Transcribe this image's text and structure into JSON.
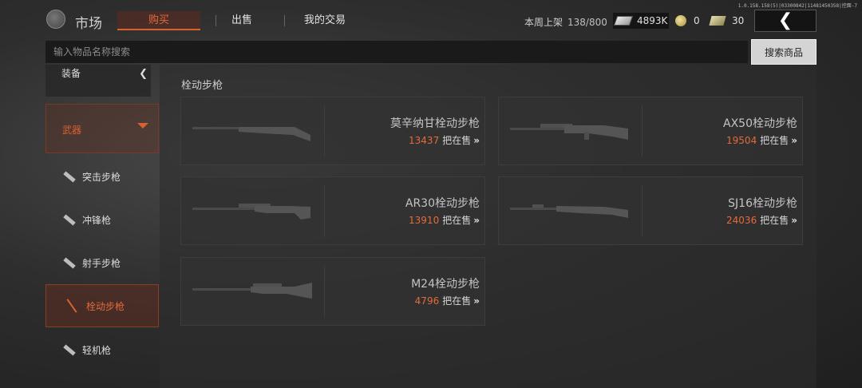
{
  "version_text": "1.0.158.158(5)|03300842|11481450358|控面-7",
  "header": {
    "title": "市场",
    "tabs": [
      {
        "label": "购买",
        "active": true
      },
      {
        "label": "出售",
        "active": false
      },
      {
        "label": "我的交易",
        "active": false
      }
    ],
    "weekly_label": "本周上架",
    "weekly_count": "138/800",
    "money": "4893K",
    "coins": "0",
    "tickets": "30",
    "back_icon": "chevron-left-icon"
  },
  "search": {
    "placeholder": "输入物品名称搜索",
    "button_label": "搜索商品"
  },
  "sidebar": {
    "equipment_label": "装备",
    "weapons_label": "武器",
    "items": [
      {
        "label": "突击步枪",
        "active": false
      },
      {
        "label": "冲锋枪",
        "active": false
      },
      {
        "label": "射手步枪",
        "active": false
      },
      {
        "label": "栓动步枪",
        "active": true
      },
      {
        "label": "轻机枪",
        "active": false
      }
    ]
  },
  "main": {
    "section_title": "栓动步枪",
    "on_sale_suffix": "把在售",
    "items": [
      {
        "name": "莫辛纳甘栓动步枪",
        "count": "13437"
      },
      {
        "name": "AX50栓动步枪",
        "count": "19504"
      },
      {
        "name": "AR30栓动步枪",
        "count": "13910"
      },
      {
        "name": "SJ16栓动步枪",
        "count": "24036"
      },
      {
        "name": "M24栓动步枪",
        "count": "4796"
      }
    ]
  },
  "colors": {
    "accent": "#e36a3a",
    "background": "#2e2e2e"
  }
}
